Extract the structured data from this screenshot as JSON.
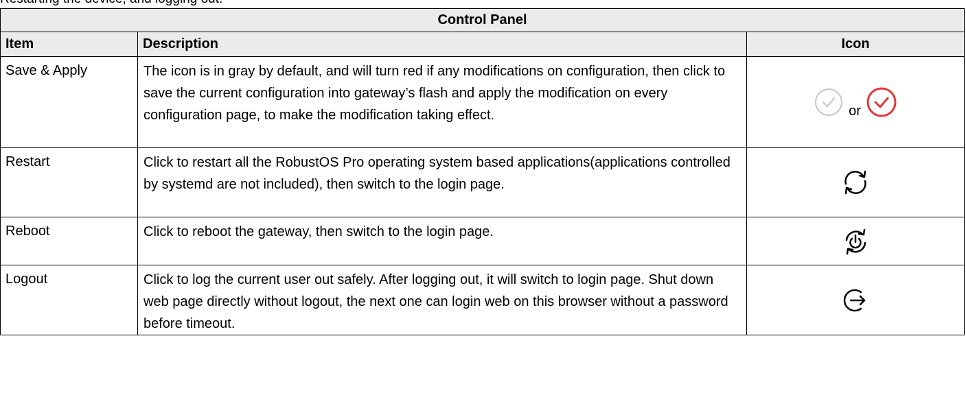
{
  "intro": "Restarting the device, and logging out.",
  "table": {
    "title": "Control Panel",
    "headers": {
      "item": "Item",
      "description": "Description",
      "icon": "Icon"
    },
    "rows": [
      {
        "item": "Save & Apply",
        "description": "The icon is in gray by default, and will turn red if any modifications on configuration, then click to save the current configuration into gateway’s flash and apply the modification on every configuration page, to make the modification taking effect.",
        "icons": [
          "check-circle-gray-icon",
          "check-circle-red-icon"
        ],
        "icon_separator": "or"
      },
      {
        "item": "Restart",
        "description": "Click to restart all the RobustOS Pro operating system based applications(applications controlled by systemd are not included), then switch to the login page.",
        "icons": [
          "restart-icon"
        ]
      },
      {
        "item": "Reboot",
        "description": "Click to reboot the gateway, then switch to the login page.",
        "icons": [
          "reboot-icon"
        ]
      },
      {
        "item": "Logout",
        "description": "Click to log the current user out safely. After logging out, it will switch to login page. Shut down web page directly without logout, the next one can login web on this browser without a password before timeout.",
        "icons": [
          "logout-icon"
        ]
      }
    ]
  },
  "colors": {
    "header_bg": "#ebebeb",
    "gray_icon": "#c4c4c4",
    "red_icon": "#e8363b",
    "border": "#000000"
  }
}
